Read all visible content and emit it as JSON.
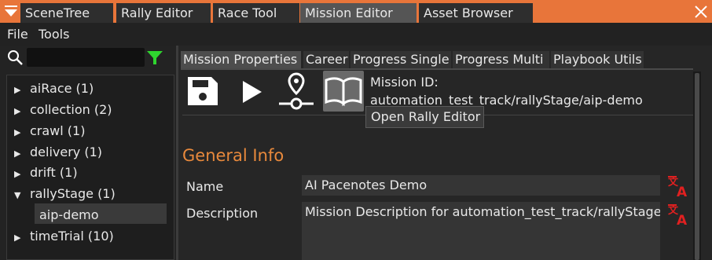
{
  "window_tabs": [
    {
      "label": "SceneTree"
    },
    {
      "label": "Rally Editor"
    },
    {
      "label": "Race Tool"
    },
    {
      "label": "Mission Editor",
      "active": true
    },
    {
      "label": "Asset Browser"
    }
  ],
  "menu": {
    "file": "File",
    "tools": "Tools"
  },
  "search": {
    "value": "",
    "placeholder": ""
  },
  "tree": [
    {
      "label": "aiRace (1)",
      "expanded": false
    },
    {
      "label": "collection (2)",
      "expanded": false
    },
    {
      "label": "crawl (1)",
      "expanded": false
    },
    {
      "label": "delivery (1)",
      "expanded": false
    },
    {
      "label": "drift (1)",
      "expanded": false
    },
    {
      "label": "rallyStage (1)",
      "expanded": true
    },
    {
      "label": "aip-demo",
      "child": true,
      "selected": true
    },
    {
      "label": "timeTrial (10)",
      "expanded": false
    }
  ],
  "sub_tabs": [
    {
      "label": "Mission Properties",
      "active": true
    },
    {
      "label": "Career"
    },
    {
      "label": "Progress Single"
    },
    {
      "label": "Progress Multi"
    },
    {
      "label": "Playbook Utils"
    }
  ],
  "toolbar": {
    "icons": [
      "save-icon",
      "play-icon",
      "map-pin-icon",
      "book-icon"
    ],
    "mission_id_label": "Mission ID:",
    "mission_id_value": "automation_test_track/rallyStage/aip-demo",
    "tooltip": "Open Rally Editor"
  },
  "general_info": {
    "title": "General Info",
    "name_label": "Name",
    "name_value": "AI Pacenotes Demo",
    "description_label": "Description",
    "description_value": "Mission Description for automation_test_track/rallyStage/aip-demo"
  },
  "colors": {
    "accent": "#e8753a",
    "section_title": "#e8893c",
    "filter": "#2fd52f",
    "translate": "#e02020"
  }
}
